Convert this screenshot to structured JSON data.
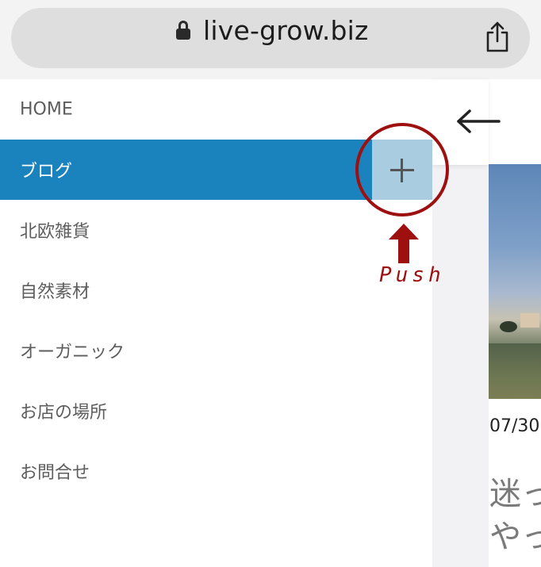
{
  "browser": {
    "url": "live-grow.biz",
    "lock_icon": "lock-icon",
    "share_icon": "share-icon"
  },
  "menu": {
    "items": [
      {
        "label": "HOME"
      },
      {
        "label": "ブログ",
        "active": true
      },
      {
        "label": "北欧雑貨"
      },
      {
        "label": "自然素材"
      },
      {
        "label": "オーガニック"
      },
      {
        "label": "お店の場所"
      },
      {
        "label": "お問合せ"
      }
    ],
    "expand_icon": "plus-icon",
    "active_color": "#1a82bd",
    "expand_color": "#a9cce1"
  },
  "page": {
    "close_icon": "arrow-left-icon",
    "date": "07/30",
    "title_peek": "迷っ\nやっ"
  },
  "annotation": {
    "text": "Push",
    "color": "#9e1010"
  }
}
